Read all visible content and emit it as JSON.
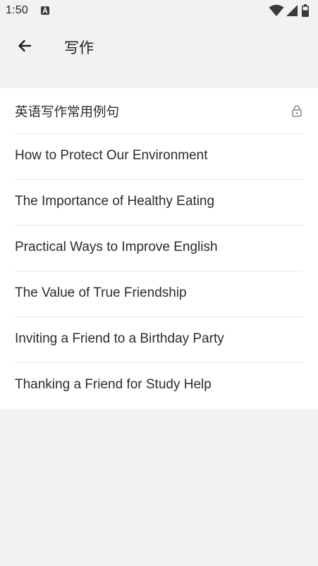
{
  "status_bar": {
    "time": "1:50",
    "notification_icon": "a-badge-icon",
    "icons": [
      "wifi-icon",
      "cellular-signal-icon",
      "battery-icon"
    ]
  },
  "header": {
    "back_icon": "arrow-left-icon",
    "title": "写作"
  },
  "list": {
    "items": [
      {
        "label": "英语写作常用例句",
        "locked": true,
        "icon": "lock-icon"
      },
      {
        "label": "How to Protect Our Environment"
      },
      {
        "label": "The Importance of Healthy Eating"
      },
      {
        "label": "Practical Ways to Improve English"
      },
      {
        "label": "The Value of True Friendship"
      },
      {
        "label": "Inviting a Friend to a Birthday Party"
      },
      {
        "label": "Thanking a Friend for Study Help"
      }
    ]
  }
}
